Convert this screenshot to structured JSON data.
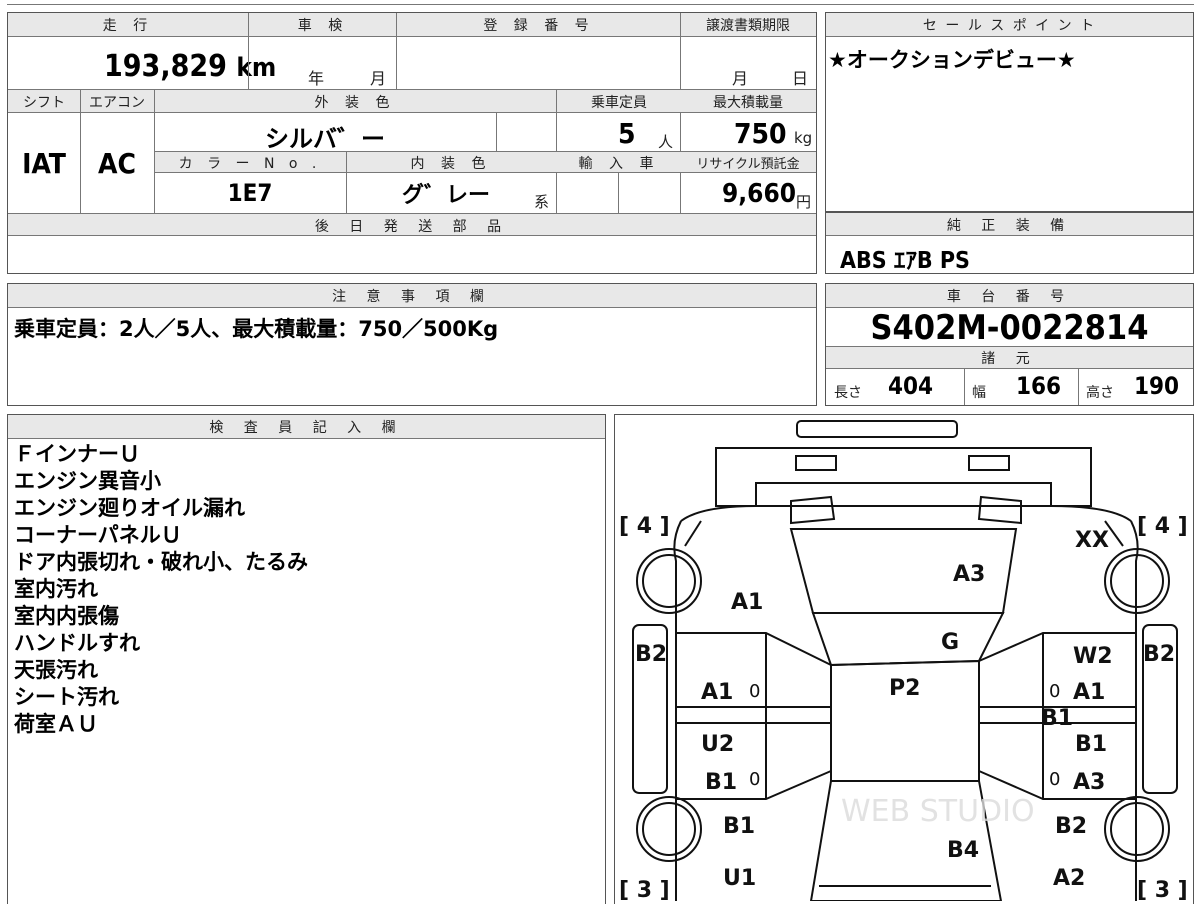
{
  "labels": {
    "mileage": "走 行",
    "shaken": "車 検",
    "registration": "登 録 番 号",
    "transfer_deadline": "譲渡書類期限",
    "sales_point": "セ ー ル ス ポ イ ン ト",
    "shift": "シフト",
    "aircon": "エアコン",
    "exterior_color": "外 装 色",
    "capacity": "乗車定員",
    "max_load": "最大積載量",
    "color_no": "カ ラ ー N o .",
    "interior_color": "内 装 色",
    "import": "輸 入 車",
    "recycle": "リサイクル預託金",
    "later_parts": "後 日 発 送 部 品",
    "genuine_equipment": "純 正 装 備",
    "notes": "注 意 事 項 欄",
    "chassis": "車 台 番 号",
    "specs": "諸 元",
    "inspector": "検 査 員 記 入 欄"
  },
  "vehicle": {
    "mileage": "193,829",
    "mileage_unit": "km",
    "shaken_year": "年",
    "shaken_month": "月",
    "deadline_month": "月",
    "deadline_day": "日",
    "sales_point": "★オークションデビュー★",
    "shift": "IAT",
    "aircon": "AC",
    "exterior_color": "シルバ゛ー",
    "capacity": "5",
    "capacity_unit": "人",
    "max_load": "750",
    "max_load_unit": "kg",
    "color_no": "1E7",
    "interior_color": "グ゛レー",
    "interior_suffix": "系",
    "recycle": "9,660",
    "recycle_unit": "円",
    "genuine_equipment": "ABS ｴｱB PS",
    "notes": "乗車定員：2人／5人、最大積載量：750／500Kg",
    "chassis_number": "S402M-0022814",
    "length_label": "長さ",
    "length": "404",
    "width_label": "幅",
    "width": "166",
    "height_label": "高さ",
    "height": "190"
  },
  "inspector_notes": [
    "ＦインナーＵ",
    "エンジン異音小",
    "エンジン廻りオイル漏れ",
    "コーナーパネルＵ",
    "ドア内張切れ・破れ小、たるみ",
    "室内汚れ",
    "室内内張傷",
    "ハンドルすれ",
    "天張汚れ",
    "シート汚れ",
    "荷室ＡＵ"
  ],
  "diagram": {
    "tires": [
      "[ 4 ]",
      "[ 4 ]",
      "[ 3 ]",
      "[ 3 ]"
    ],
    "marks": {
      "xx": "XX",
      "a3_top": "A3",
      "a1_fl": "A1",
      "g": "G",
      "b2_left": "B2",
      "b2_right": "B2",
      "w2": "W2",
      "a1_ld": "A1",
      "zero_ld": "0",
      "p2": "P2",
      "zero_rd": "0",
      "a1_rd": "A1",
      "b1_center": "B1",
      "u2": "U2",
      "b1_rd2": "B1",
      "b1_lr": "B1",
      "zero_lr": "0",
      "zero_rr": "0",
      "a3_rr": "A3",
      "b1_lq": "B1",
      "b2_rq": "B2",
      "b4": "B4",
      "u1": "U1",
      "a2": "A2"
    },
    "watermark": "WEB STUDIO"
  }
}
